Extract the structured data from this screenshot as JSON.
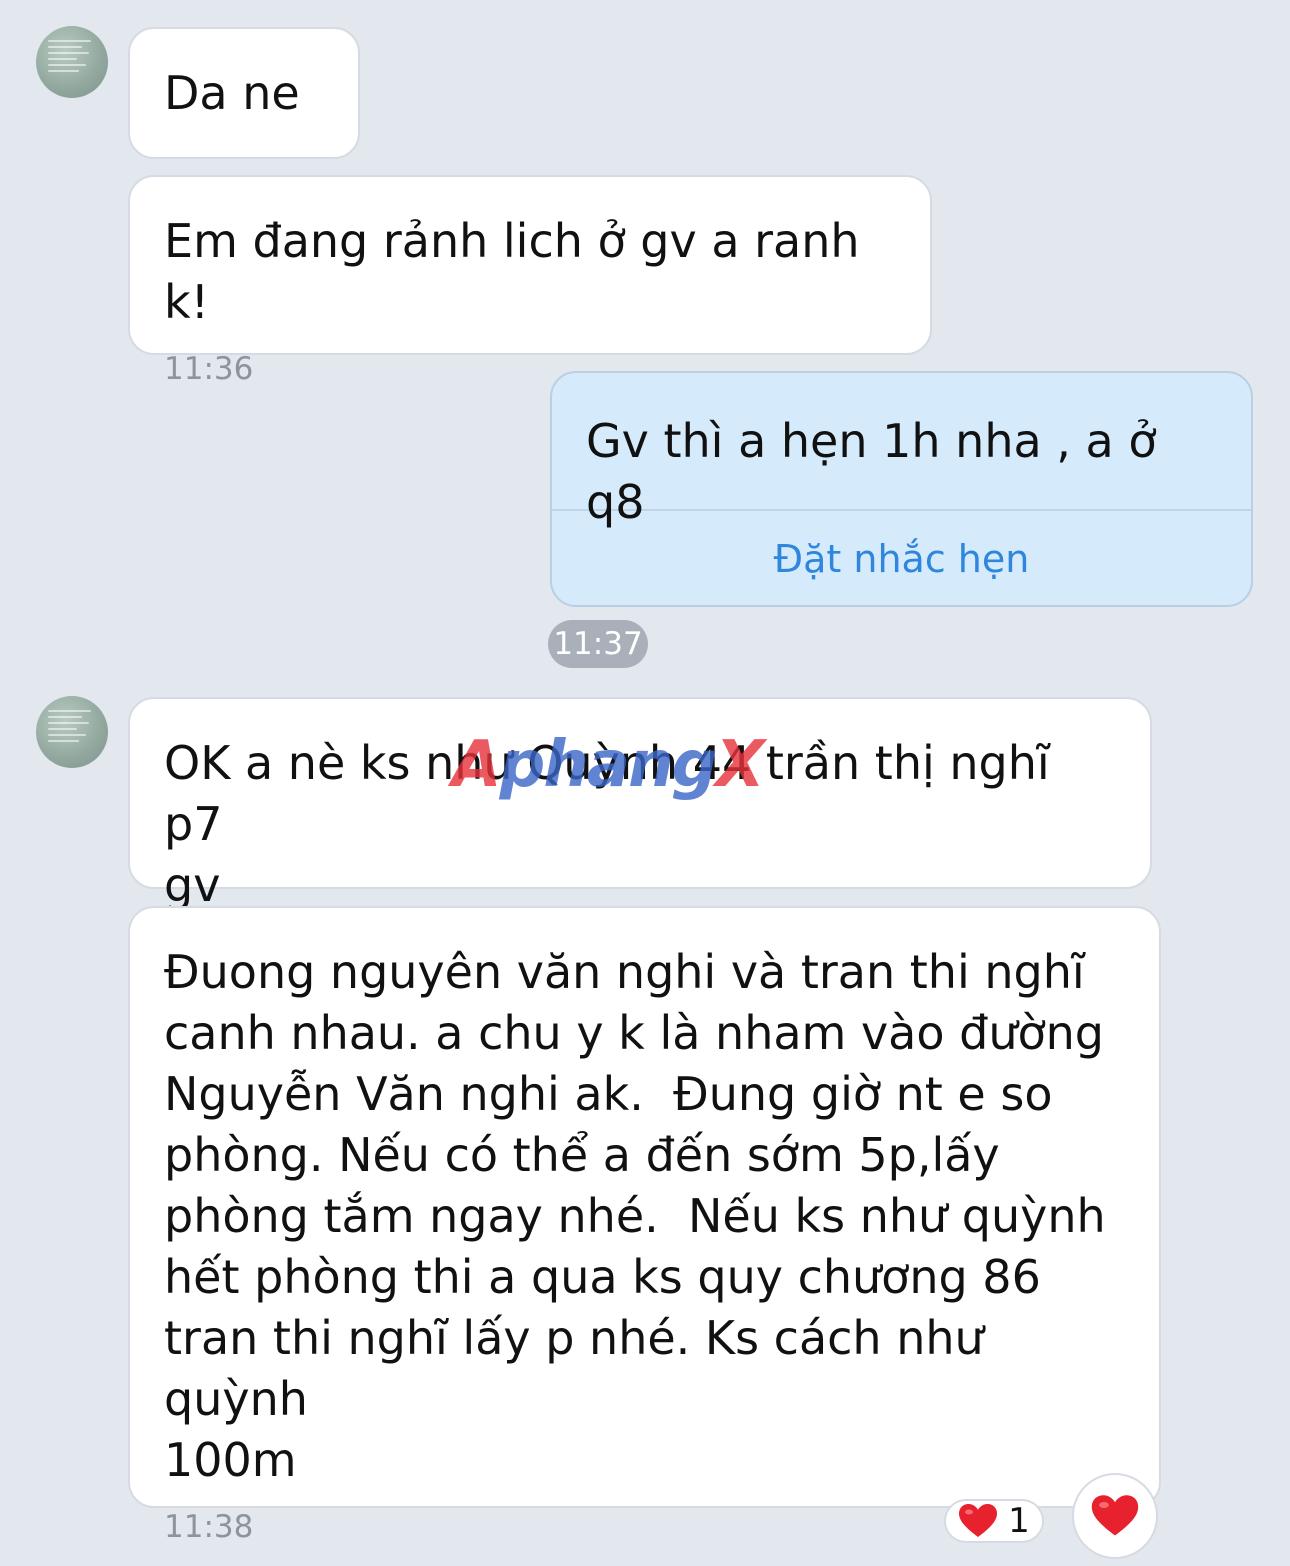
{
  "messages": [
    {
      "text": "Da ne"
    },
    {
      "text": "Em đang rảnh lich ở gv a ranh k!",
      "time": "11:36"
    },
    {
      "text": "Gv thì a hẹn 1h nha , a ở q8",
      "action_label": "Đặt nhắc hẹn"
    },
    {
      "text": "OK a nè ks như Quỳnh 44 trần thị nghĩ p7\ngv"
    },
    {
      "text": "Đuong nguyên văn nghi và tran thi nghĩ\ncanh nhau. a chu y k là nham vào đường\nNguyễn Văn nghi ak.  Đung giờ nt e so\nphòng. Nếu có thể a đến sớm 5p,lấy\nphòng tắm ngay nhé.  Nếu ks như quỳnh\nhết phòng thi a qua ks quy chương 86\ntran thi nghĩ lấy p nhé. Ks cách như quỳnh\n100m",
      "time": "11:38"
    }
  ],
  "divider_time": "11:37",
  "reactions": {
    "icon": "heart-icon",
    "count": "1",
    "button_icon": "heart-icon"
  },
  "watermark": {
    "part1": "A",
    "part2": "phang",
    "part3": "X"
  },
  "colors": {
    "background": "#e3e7ee",
    "sent_bubble": "#d5ebfb",
    "action": "#2f86dc",
    "heart": "#e8212e"
  }
}
